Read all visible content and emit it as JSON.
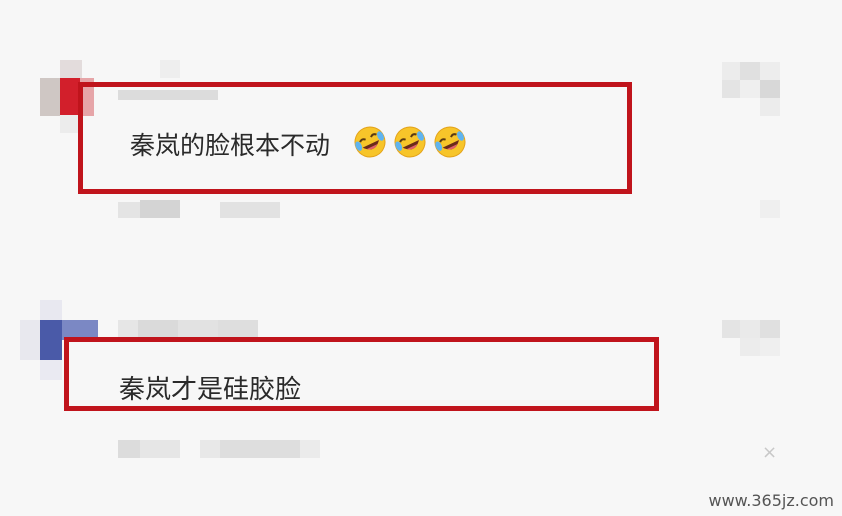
{
  "comments": [
    {
      "text": "秦岚的脸根本不动",
      "reactions": [
        "rolling-laughing-emoji",
        "rolling-laughing-emoji",
        "rolling-laughing-emoji"
      ]
    },
    {
      "text": "秦岚才是硅胶脸"
    }
  ],
  "watermark": "www.365jz.com",
  "colors": {
    "highlight": "#c0141c",
    "text": "#2a2a2a",
    "background": "#f7f7f7"
  },
  "icons": {
    "close": "×"
  }
}
